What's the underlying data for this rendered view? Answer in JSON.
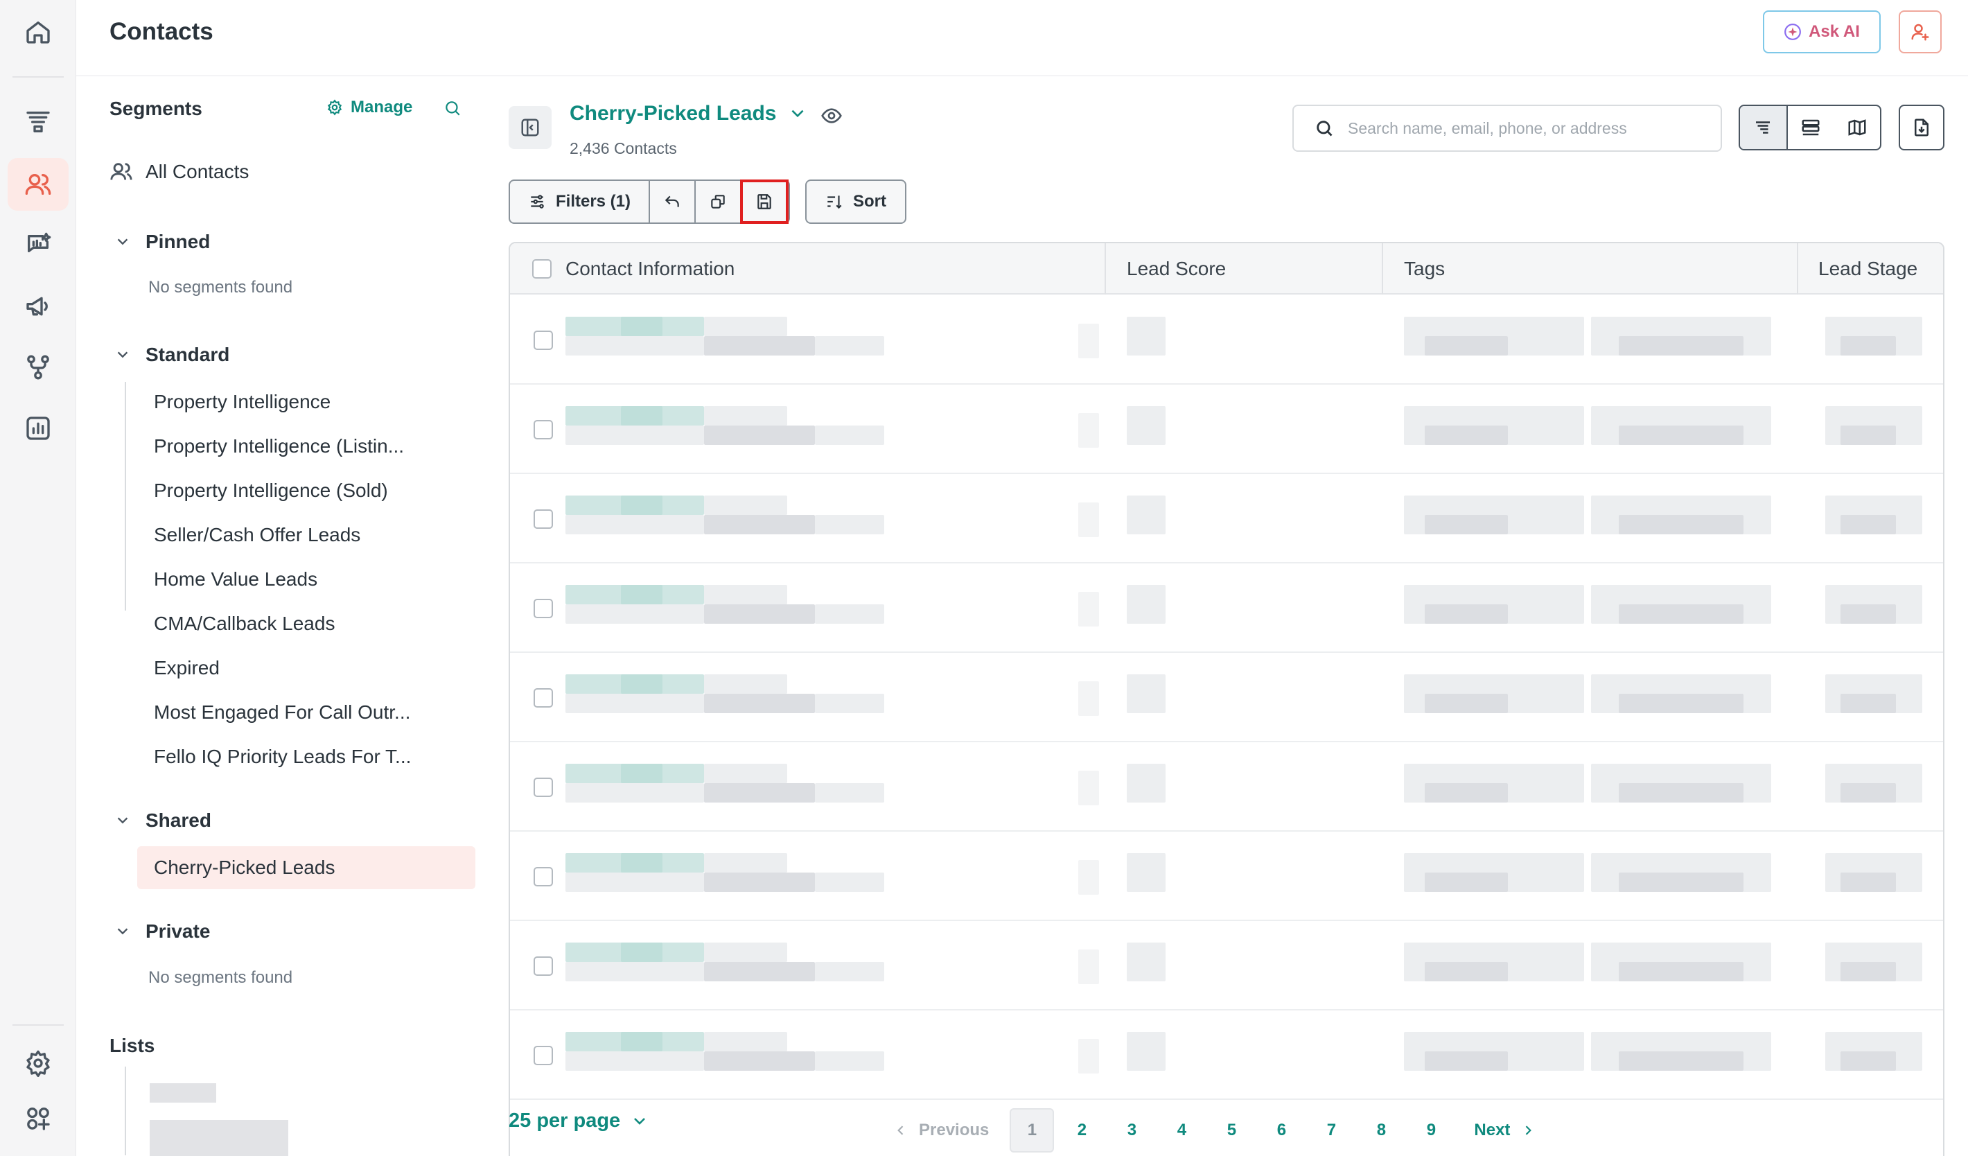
{
  "header": {
    "title": "Contacts",
    "ask_ai_label": "Ask AI"
  },
  "rail": {
    "items": [
      "home-icon",
      "funnel-icon",
      "contacts-icon",
      "conversations-icon",
      "campaigns-icon",
      "workflows-icon",
      "reports-icon"
    ],
    "bottom": [
      "settings-icon",
      "apps-icon"
    ]
  },
  "segments": {
    "title": "Segments",
    "manage_label": "Manage",
    "all_contacts": "All Contacts",
    "pinned": {
      "label": "Pinned",
      "empty": "No segments found"
    },
    "standard": {
      "label": "Standard",
      "items": [
        "Property Intelligence",
        "Property Intelligence (Listin...",
        "Property Intelligence (Sold)",
        "Seller/Cash Offer Leads",
        "Home Value Leads",
        "CMA/Callback Leads",
        "Expired",
        "Most Engaged For Call Outr...",
        "Fello IQ Priority Leads For T..."
      ]
    },
    "shared": {
      "label": "Shared",
      "items": [
        "Cherry-Picked Leads"
      ]
    },
    "private": {
      "label": "Private",
      "empty": "No segments found"
    },
    "lists_label": "Lists"
  },
  "main": {
    "segment_name": "Cherry-Picked Leads",
    "contact_count": "2,436 Contacts",
    "search_placeholder": "Search name, email, phone, or address",
    "filters_label": "Filters (1)",
    "sort_label": "Sort"
  },
  "table": {
    "columns": [
      "Contact Information",
      "Lead Score",
      "Tags",
      "Lead Stage"
    ],
    "row_count": 9
  },
  "pagination": {
    "per_page": "25 per page",
    "previous": "Previous",
    "next": "Next",
    "pages": [
      "1",
      "2",
      "3",
      "4",
      "5",
      "6",
      "7",
      "8",
      "9"
    ],
    "current": "1"
  },
  "colors": {
    "accent": "#0f8a7e",
    "brand": "#e8604c",
    "highlight": "#e02020"
  }
}
